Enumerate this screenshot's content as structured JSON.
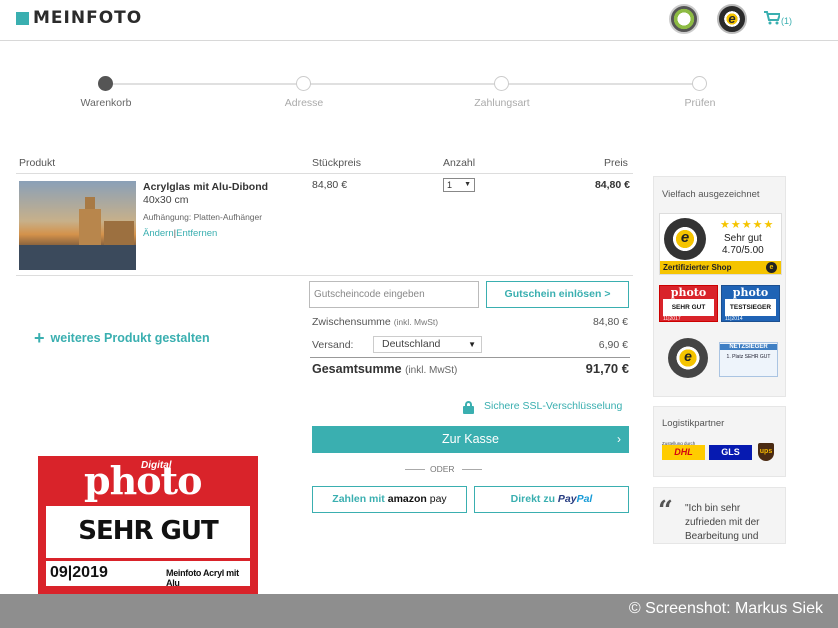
{
  "header": {
    "logo_text": "MEINFOTO",
    "cart_count": "(1)",
    "cart_icon": "cart-icon",
    "brand_color": "#3aafb0"
  },
  "steps": [
    {
      "label": "Warenkorb",
      "active": true
    },
    {
      "label": "Adresse",
      "active": false
    },
    {
      "label": "Zahlungsart",
      "active": false
    },
    {
      "label": "Prüfen",
      "active": false
    }
  ],
  "table": {
    "headers": {
      "product": "Produkt",
      "unit_price": "Stückpreis",
      "quantity": "Anzahl",
      "price": "Preis"
    },
    "item": {
      "title": "Acrylglas mit Alu-Dibond",
      "size": "40x30 cm",
      "hanging": "Aufhängung: Platten-Aufhänger",
      "edit_link": "Ändern",
      "separator": "|",
      "remove_link": "Entfernen",
      "unit_price": "84,80 €",
      "quantity": "1",
      "price": "84,80 €"
    }
  },
  "coupon": {
    "placeholder": "Gutscheincode eingeben",
    "button": "Gutschein einlösen >"
  },
  "summary": {
    "subtotal_label": "Zwischensumme",
    "subtotal_note": "(inkl. MwSt)",
    "subtotal_value": "84,80 €",
    "shipping_label": "Versand:",
    "shipping_country": "Deutschland",
    "shipping_value": "6,90 €",
    "total_label": "Gesamtsumme",
    "total_note": "(inkl. MwSt)",
    "total_value": "91,70 €"
  },
  "ssl_text": "Sichere SSL-Verschlüsselung",
  "checkout_button": "Zur Kasse",
  "checkout_chevron": "›",
  "or_text": "ODER",
  "amazon_button": {
    "prefix": "Zahlen mit",
    "brand": "amazon",
    "suffix": "pay"
  },
  "paypal_button": {
    "prefix": "Direkt zu",
    "brand_a": "Pay",
    "brand_b": "Pal"
  },
  "add_product": {
    "plus": "+",
    "label": "weiteres Produkt gestalten"
  },
  "award": {
    "digital": "Digital",
    "photo": "photo",
    "rating": "SEHR GUT",
    "date": "09|2019",
    "product": "Meinfoto Acryl mit Alu"
  },
  "sidebar": {
    "awards_title": "Vielfach ausgezeichnet",
    "ts_stars": "★★★★★",
    "ts_rating": "Sehr gut",
    "ts_score": "4.70/5.00",
    "ts_bar": "Zertifizierter Shop",
    "ts_seal_letter": "e",
    "mini_award_1": {
      "brand": "photo",
      "rating": "SEHR GUT",
      "date": "11|2017"
    },
    "mini_award_2": {
      "brand": "photo",
      "rating": "TESTSIEGER",
      "date": "11|2014"
    },
    "netz_title": "NETZSIEGER",
    "netz_sub": "1. Platz SEHR GUT",
    "logistics_title": "Logistikpartner",
    "logistics_caption": "Zustellung durch",
    "dhl": "DHL",
    "gls": "GLS",
    "ups": "ups",
    "quote_mark": "“",
    "quote_text": "\"Ich bin sehr zufrieden mit der Bearbeitung und"
  },
  "footer_credit": "© Screenshot: Markus Siek"
}
